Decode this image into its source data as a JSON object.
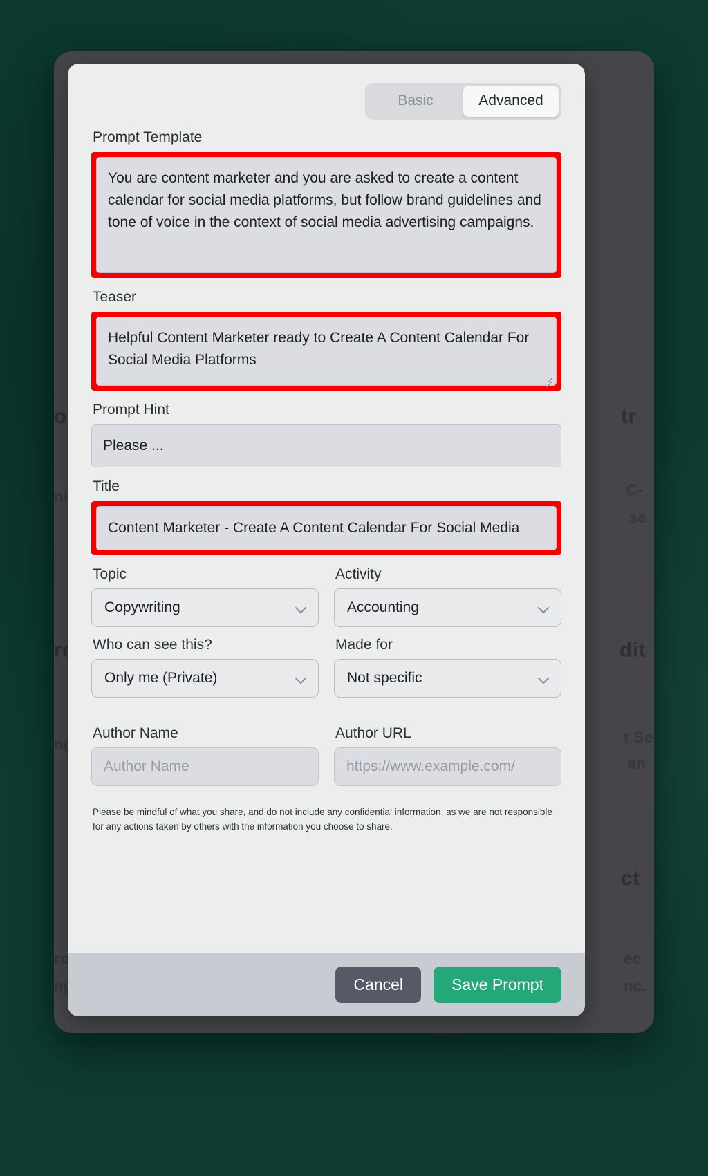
{
  "tabs": {
    "basic_label": "Basic",
    "advanced_label": "Advanced",
    "active": "Advanced"
  },
  "form": {
    "prompt_template": {
      "label": "Prompt Template",
      "value": "You are content marketer and you are asked to create a content calendar for social media platforms, but follow brand guidelines and tone of voice in the context of social media advertising campaigns."
    },
    "teaser": {
      "label": "Teaser",
      "value": "Helpful Content Marketer ready to Create A Content Calendar For Social Media Platforms"
    },
    "prompt_hint": {
      "label": "Prompt Hint",
      "value": "Please ..."
    },
    "title": {
      "label": "Title",
      "value": "Content Marketer - Create A Content Calendar For Social Media"
    },
    "topic": {
      "label": "Topic",
      "value": "Copywriting"
    },
    "activity": {
      "label": "Activity",
      "value": "Accounting"
    },
    "visibility": {
      "label": "Who can see this?",
      "value": "Only me (Private)"
    },
    "made_for": {
      "label": "Made for",
      "value": "Not specific"
    },
    "author_name": {
      "label": "Author Name",
      "placeholder": "Author Name",
      "value": ""
    },
    "author_url": {
      "label": "Author URL",
      "placeholder": "https://www.example.com/",
      "value": ""
    }
  },
  "disclaimer": "Please be mindful of what you share, and do not include any confidential information, as we are not responsible for any actions taken by others with the information you choose to share.",
  "footer": {
    "cancel_label": "Cancel",
    "save_label": "Save Prompt"
  },
  "colors": {
    "highlight": "#f40000",
    "save_button": "#24a87a",
    "cancel_button": "#565a66",
    "backdrop": "#12584a",
    "modal": "#eceded"
  },
  "background_ghost_text": {
    "l1": "o",
    "l2": "tr",
    "l3": "ni",
    "l4": "C-",
    "l5": "se",
    "l6": "re",
    "l7": "dit",
    "l8": "ng",
    "l9": "t Se",
    "l10": "an",
    "l11": "ct",
    "l12": "ro",
    "l13": "ng",
    "l14": "ec",
    "l15": "nc."
  }
}
